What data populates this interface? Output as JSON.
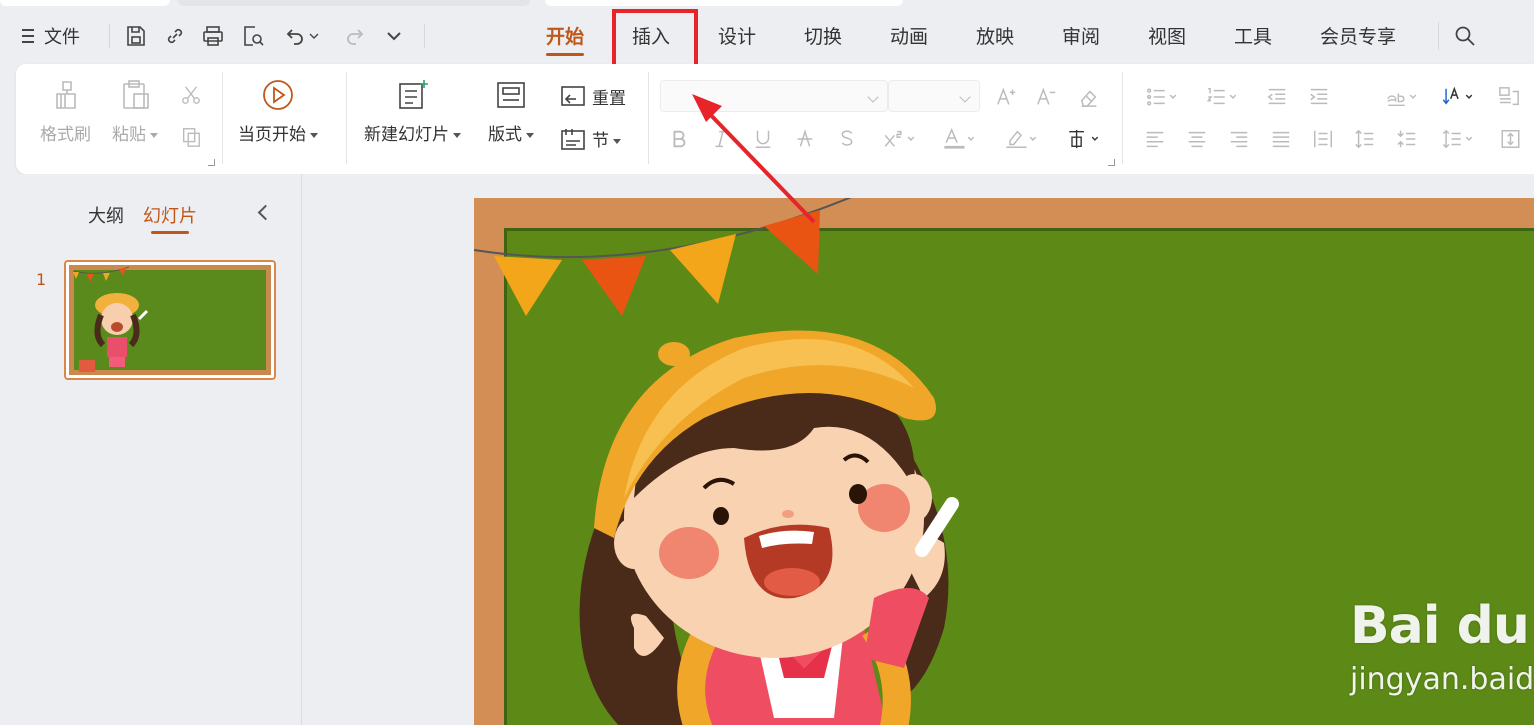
{
  "menubar": {
    "file_label": "文件",
    "tabs": [
      {
        "label": "开始",
        "active": true
      },
      {
        "label": "插入",
        "active": false,
        "highlighted": true
      },
      {
        "label": "设计",
        "active": false
      },
      {
        "label": "切换",
        "active": false
      },
      {
        "label": "动画",
        "active": false
      },
      {
        "label": "放映",
        "active": false
      },
      {
        "label": "审阅",
        "active": false
      },
      {
        "label": "视图",
        "active": false
      },
      {
        "label": "工具",
        "active": false
      },
      {
        "label": "会员专享",
        "active": false
      }
    ],
    "quick_access_icons": [
      "save-icon",
      "link-icon",
      "print-icon",
      "print-preview-icon",
      "undo-icon",
      "redo-icon",
      "more-chevron-icon"
    ]
  },
  "ribbon": {
    "format_painter": "格式刷",
    "paste": "粘贴",
    "play_from_current": "当页开始",
    "new_slide": "新建幻灯片",
    "layout": "版式",
    "reset": "重置",
    "section": "节"
  },
  "left_panel": {
    "tab_outline": "大纲",
    "tab_slides": "幻灯片",
    "slide_number": "1"
  },
  "watermark": {
    "logo": "Bai du 经验",
    "url": "jingyan.baidu.com"
  },
  "colors": {
    "accent": "#c0571a",
    "highlight_box": "#e8242b",
    "board_green": "#5d8a16",
    "frame_wood": "#d28e55"
  }
}
